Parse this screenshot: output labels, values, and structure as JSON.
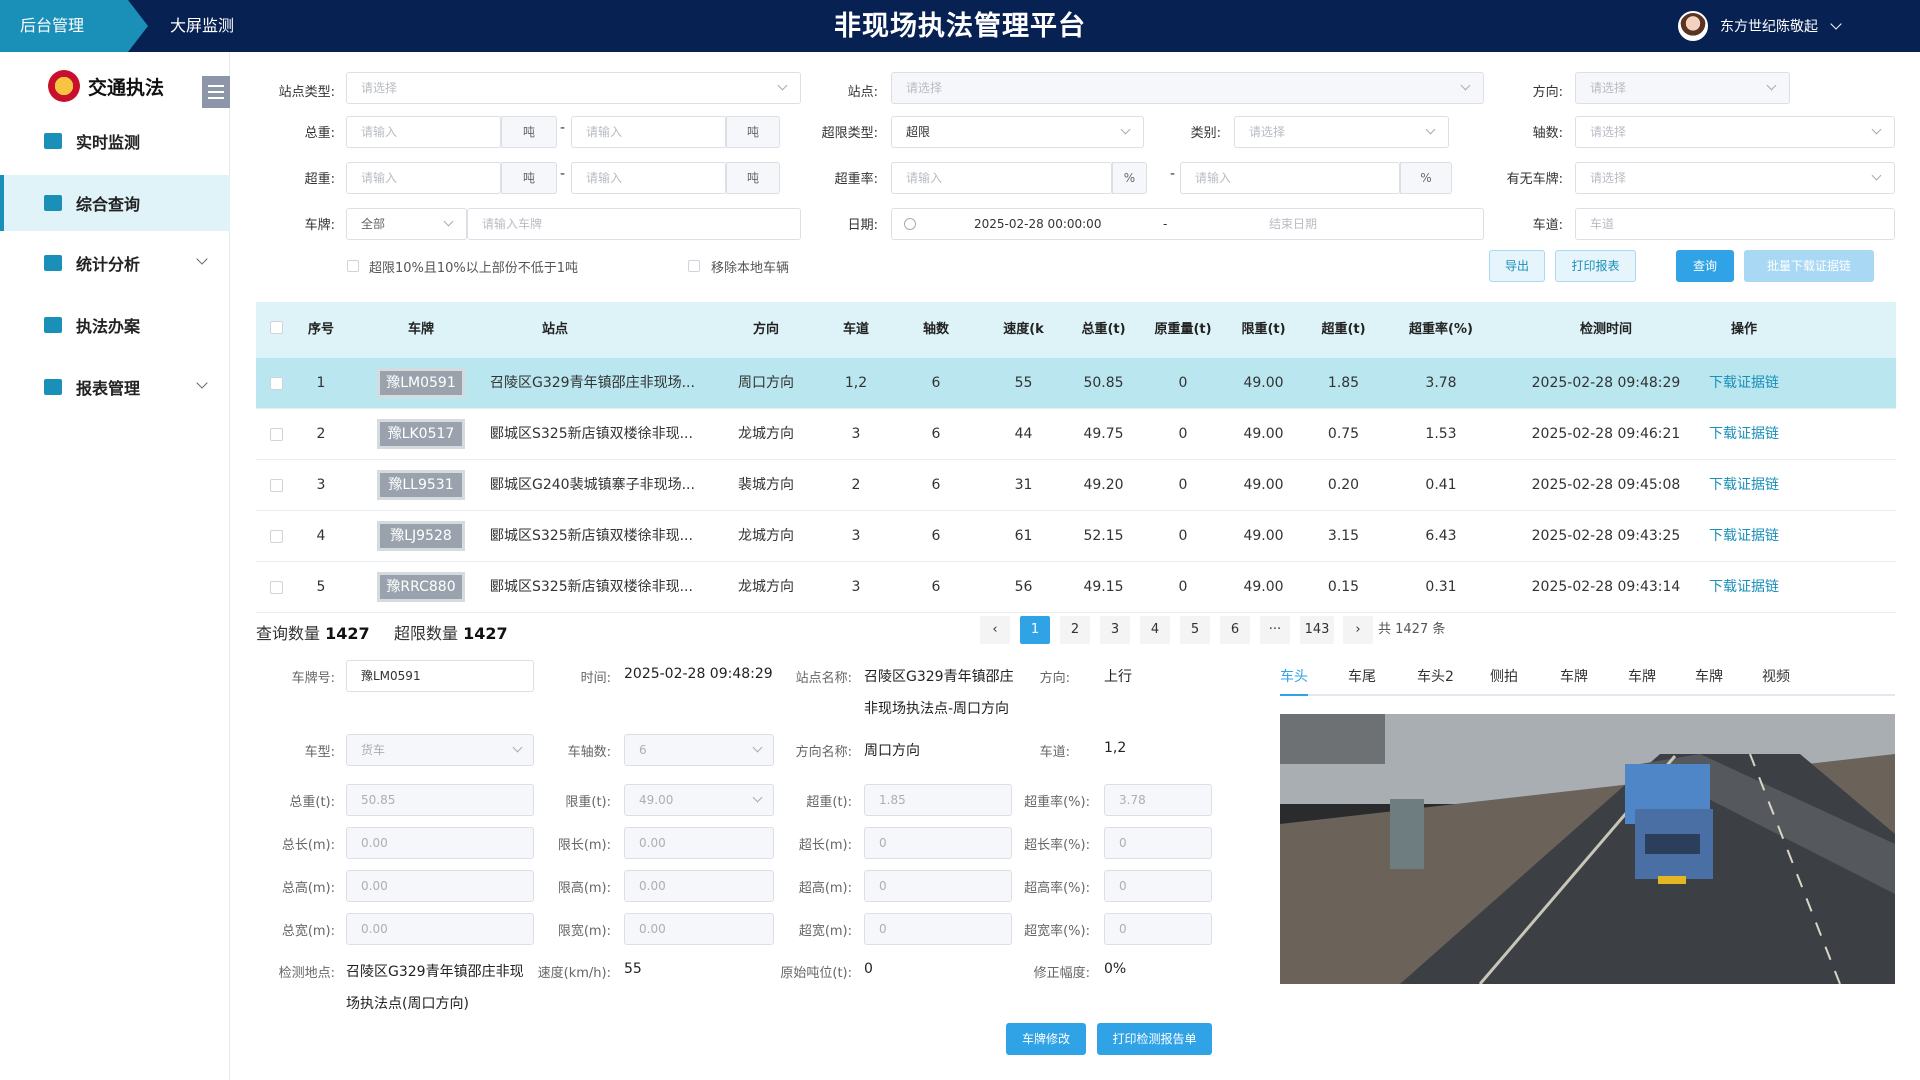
{
  "header": {
    "active_tab": "后台管理",
    "tab2": "大屏监测",
    "title": "非现场执法管理平台",
    "user": "东方世纪陈敬起"
  },
  "sidebar": {
    "logo": "交通执法",
    "items": [
      {
        "label": "实时监测",
        "expandable": false,
        "active": false
      },
      {
        "label": "综合查询",
        "expandable": false,
        "active": true
      },
      {
        "label": "统计分析",
        "expandable": true,
        "active": false
      },
      {
        "label": "执法办案",
        "expandable": false,
        "active": false
      },
      {
        "label": "报表管理",
        "expandable": true,
        "active": false
      }
    ]
  },
  "filters": {
    "station_type": {
      "label": "站点类型:",
      "placeholder": "请选择"
    },
    "station": {
      "label": "站点:",
      "placeholder": "请选择"
    },
    "direction": {
      "label": "方向:",
      "placeholder": "请选择"
    },
    "total_weight": {
      "label": "总重:",
      "ph1": "请输入",
      "ph2": "请输入",
      "unit": "吨"
    },
    "overlimit_type": {
      "label": "超限类型:",
      "value": "超限"
    },
    "category": {
      "label": "类别:",
      "placeholder": "请选择"
    },
    "axles": {
      "label": "轴数:",
      "placeholder": "请选择"
    },
    "overweight": {
      "label": "超重:",
      "ph1": "请输入",
      "ph2": "请输入",
      "unit": "吨"
    },
    "overweight_rate": {
      "label": "超重率:",
      "ph1": "请输入",
      "ph2": "请输入",
      "unit": "%"
    },
    "has_plate": {
      "label": "有无车牌:",
      "placeholder": "请选择"
    },
    "plate": {
      "label": "车牌:",
      "prefix": "全部",
      "placeholder": "请输入车牌"
    },
    "date": {
      "label": "日期:",
      "start": "2025-02-28 00:00:00",
      "sep": "-",
      "end_placeholder": "结束日期"
    },
    "lane": {
      "label": "车道:",
      "placeholder": "车道"
    },
    "check1": "超限10%且10%以上部份不低于1吨",
    "check2": "移除本地车辆",
    "buttons": {
      "export": "导出",
      "print": "打印报表",
      "query": "查询",
      "batch": "批量下载证据链"
    }
  },
  "table": {
    "headers": [
      "序号",
      "车牌",
      "站点",
      "方向",
      "车道",
      "轴数",
      "速度(k",
      "总重(t)",
      "原重量(t)",
      "限重(t)",
      "超重(t)",
      "超重率(%)",
      "检测时间",
      "操作"
    ],
    "rows": [
      [
        "1",
        "豫LM0591",
        "召陵区G329青年镇邵庄非现场...",
        "周口方向",
        "1,2",
        "6",
        "55",
        "50.85",
        "0",
        "49.00",
        "1.85",
        "3.78",
        "2025-02-28 09:48:29",
        "下载证据链"
      ],
      [
        "2",
        "豫LK0517",
        "郾城区S325新店镇双楼徐非现...",
        "龙城方向",
        "3",
        "6",
        "44",
        "49.75",
        "0",
        "49.00",
        "0.75",
        "1.53",
        "2025-02-28 09:46:21",
        "下载证据链"
      ],
      [
        "3",
        "豫LL9531",
        "郾城区G240裴城镇寨子非现场...",
        "裴城方向",
        "2",
        "6",
        "31",
        "49.20",
        "0",
        "49.00",
        "0.20",
        "0.41",
        "2025-02-28 09:45:08",
        "下载证据链"
      ],
      [
        "4",
        "豫LJ9528",
        "郾城区S325新店镇双楼徐非现...",
        "龙城方向",
        "3",
        "6",
        "61",
        "52.15",
        "0",
        "49.00",
        "3.15",
        "6.43",
        "2025-02-28 09:43:25",
        "下载证据链"
      ],
      [
        "5",
        "豫RRC880",
        "郾城区S325新店镇双楼徐非现...",
        "龙城方向",
        "3",
        "6",
        "56",
        "49.15",
        "0",
        "49.00",
        "0.15",
        "0.31",
        "2025-02-28 09:43:14",
        "下载证据链"
      ]
    ]
  },
  "summary": {
    "query_label": "查询数量",
    "query_count": "1427",
    "over_label": "超限数量",
    "over_count": "1427"
  },
  "pager": {
    "pages": [
      "1",
      "2",
      "3",
      "4",
      "5",
      "6",
      "···",
      "143"
    ],
    "current": "1",
    "total": "共 1427 条"
  },
  "detail": {
    "plate_label": "车牌号:",
    "plate": "豫LM0591",
    "time_label": "时间:",
    "time": "2025-02-28 09:48:29",
    "station_label": "站点名称:",
    "station_l1": "召陵区G329青年镇邵庄",
    "station_l2": "非现场执法点-周口方向",
    "dir_label": "方向:",
    "dir": "上行",
    "vtype_label": "车型:",
    "vtype": "货车",
    "axle_label": "车轴数:",
    "axle": "6",
    "dirname_label": "方向名称:",
    "dirname": "周口方向",
    "lane_label": "车道:",
    "lane": "1,2",
    "tw_label": "总重(t):",
    "tw": "50.85",
    "lw_label": "限重(t):",
    "lw": "49.00",
    "ow_label": "超重(t):",
    "ow": "1.85",
    "owr_label": "超重率(%):",
    "owr": "3.78",
    "tl_label": "总长(m):",
    "tl": "0.00",
    "ll_label": "限长(m):",
    "ll": "0.00",
    "ol_label": "超长(m):",
    "ol": "0",
    "olr_label": "超长率(%):",
    "olr": "0",
    "th_label": "总高(m):",
    "th": "0.00",
    "lh_label": "限高(m):",
    "lh": "0.00",
    "oh_label": "超高(m):",
    "oh": "0",
    "ohr_label": "超高率(%):",
    "ohr": "0",
    "twd_label": "总宽(m):",
    "twd": "0.00",
    "lwd_label": "限宽(m):",
    "lwd": "0.00",
    "owd_label": "超宽(m):",
    "owd": "0",
    "owdr_label": "超宽率(%):",
    "owdr": "0",
    "site_label": "检测地点:",
    "site_l1": "召陵区G329青年镇邵庄非现",
    "site_l2": "场执法点(周口方向)",
    "speed_label": "速度(km/h):",
    "speed": "55",
    "orig_label": "原始吨位(t):",
    "orig": "0",
    "fix_label": "修正幅度:",
    "fix": "0%",
    "btn_fix": "车牌修改",
    "btn_print": "打印检测报告单"
  },
  "image_tabs": [
    "车头",
    "车尾",
    "车头2",
    "侧拍",
    "车牌",
    "车牌",
    "车牌",
    "视频"
  ],
  "colors": {
    "header": "#072153",
    "accent": "#1a8fb8",
    "primary": "#2fa3e6",
    "selected_row": "#b9e6ef",
    "table_head": "#def3f8"
  }
}
